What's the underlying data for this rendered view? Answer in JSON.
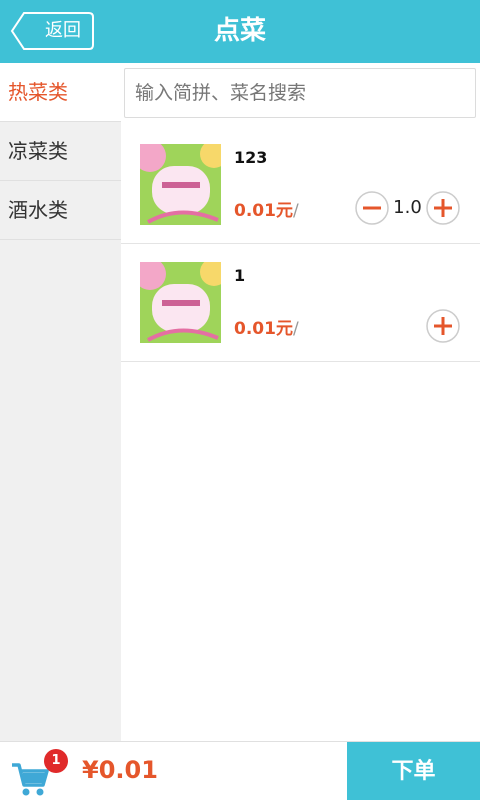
{
  "header": {
    "title": "点菜",
    "back_label": "返回"
  },
  "search": {
    "placeholder": "输入简拼、菜名搜索",
    "value": ""
  },
  "sidebar": {
    "items": [
      {
        "label": "热菜类",
        "active": true
      },
      {
        "label": "凉菜类",
        "active": false
      },
      {
        "label": "酒水类",
        "active": false
      }
    ]
  },
  "dishes": [
    {
      "name": "123",
      "price": "0.01元",
      "unit_sep": "/",
      "quantity": "1.0",
      "image_icon": "dish-photo-icon"
    },
    {
      "name": "1",
      "price": "0.01元",
      "unit_sep": "/",
      "image_icon": "dish-photo-icon"
    }
  ],
  "footer": {
    "cart_count": "1",
    "total": "¥0.01",
    "order_label": "下单"
  },
  "colors": {
    "accent": "#3fc1d6",
    "price": "#e5562b",
    "badge": "#e02a2a",
    "sidebar_bg": "#f0f0f0"
  }
}
